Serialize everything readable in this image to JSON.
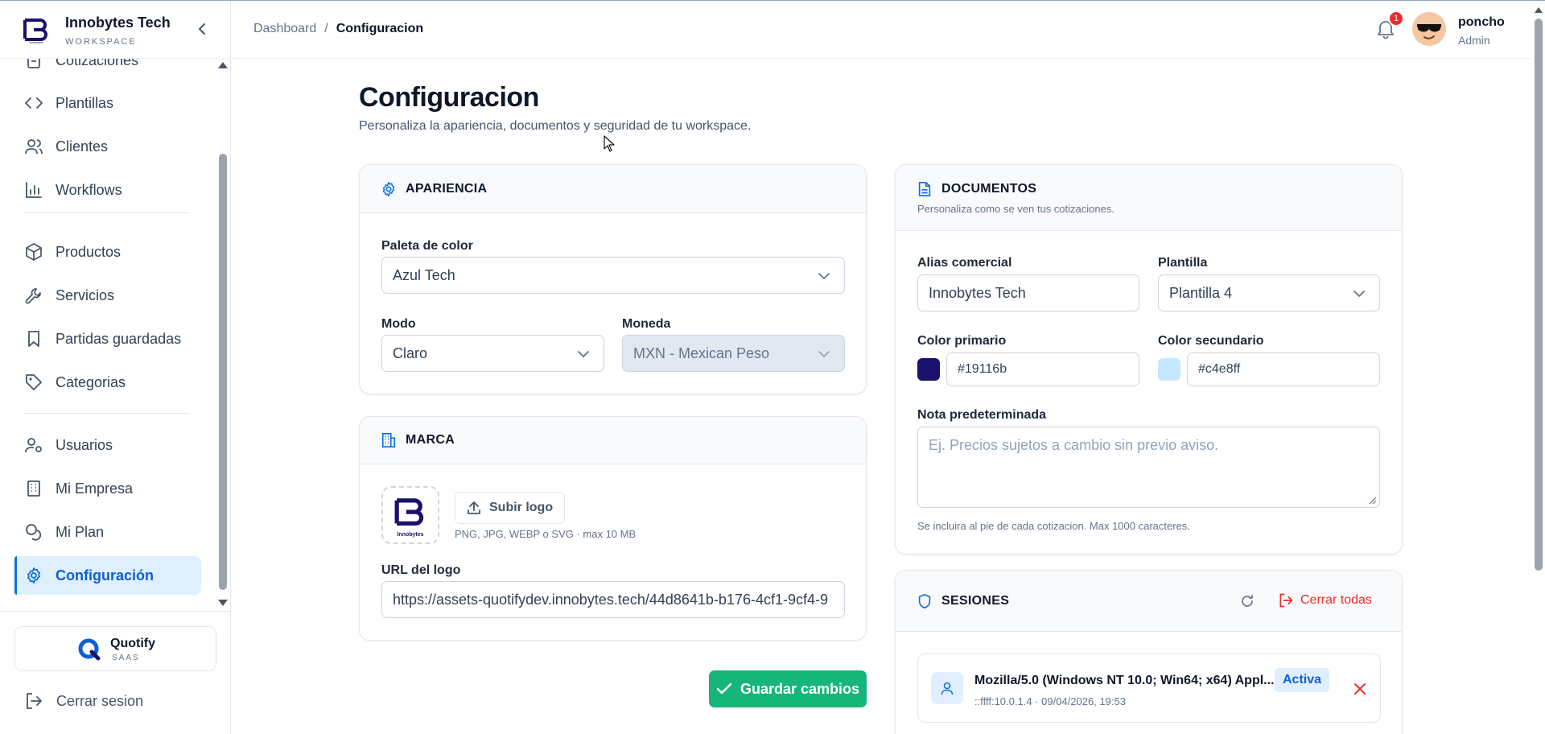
{
  "brand": {
    "name": "Innobytes Tech",
    "sub": "WORKSPACE"
  },
  "sidebar": {
    "items": [
      {
        "label": "Cotizaciones",
        "icon": "document-icon"
      },
      {
        "label": "Plantillas",
        "icon": "code-icon"
      },
      {
        "label": "Clientes",
        "icon": "users-icon"
      },
      {
        "label": "Workflows",
        "icon": "bar-chart-icon"
      },
      {
        "label": "Productos",
        "icon": "box-icon"
      },
      {
        "label": "Servicios",
        "icon": "wrench-icon"
      },
      {
        "label": "Partidas guardadas",
        "icon": "bookmark-icon"
      },
      {
        "label": "Categorias",
        "icon": "tag-icon"
      },
      {
        "label": "Usuarios",
        "icon": "user-cog-icon"
      },
      {
        "label": "Mi Empresa",
        "icon": "building-icon"
      },
      {
        "label": "Mi Plan",
        "icon": "coins-icon"
      },
      {
        "label": "Configuración",
        "icon": "gear-icon",
        "active": true
      }
    ],
    "product": {
      "name": "Quotify",
      "sub": "SAAS"
    },
    "logout_label": "Cerrar sesion"
  },
  "header": {
    "breadcrumb": [
      "Dashboard",
      "Configuracion"
    ],
    "notifications": "1",
    "user": {
      "name": "poncho",
      "role": "Admin"
    }
  },
  "page": {
    "title": "Configuracion",
    "subtitle": "Personaliza la apariencia, documentos y seguridad de tu workspace."
  },
  "apariencia": {
    "title": "APARIENCIA",
    "palette_label": "Paleta de color",
    "palette_value": "Azul Tech",
    "mode_label": "Modo",
    "mode_value": "Claro",
    "currency_label": "Moneda",
    "currency_value": "MXN - Mexican Peso"
  },
  "marca": {
    "title": "MARCA",
    "logo_text": "Innobytes",
    "upload_label": "Subir logo",
    "upload_hint": "PNG, JPG, WEBP o SVG · max 10 MB",
    "url_label": "URL del logo",
    "url_value": "https://assets-quotifydev.innobytes.tech/44d8641b-b176-4cf1-9cf4-9"
  },
  "documentos": {
    "title": "DOCUMENTOS",
    "subtitle": "Personaliza como se ven tus cotizaciones.",
    "alias_label": "Alias comercial",
    "alias_value": "Innobytes Tech",
    "template_label": "Plantilla",
    "template_value": "Plantilla 4",
    "primary_label": "Color primario",
    "primary_value": "#19116b",
    "secondary_label": "Color secundario",
    "secondary_value": "#c4e8ff",
    "note_label": "Nota predeterminada",
    "note_placeholder": "Ej. Precios sujetos a cambio sin previo aviso.",
    "note_hint": "Se incluira al pie de cada cotizacion. Max 1000 caracteres."
  },
  "sesiones": {
    "title": "SESIONES",
    "close_all_label": "Cerrar todas",
    "items": [
      {
        "agent": "Mozilla/5.0 (Windows NT 10.0; Win64; x64) Appl...",
        "meta": "::ffff:10.0.1.4 · 09/04/2026, 19:53",
        "status": "Activa"
      }
    ]
  },
  "save_label": "Guardar cambios",
  "colors": {
    "accent": "#0b6fe0",
    "save": "#16b57a",
    "danger": "#ef2b2b",
    "brand_navy": "#19116b"
  }
}
